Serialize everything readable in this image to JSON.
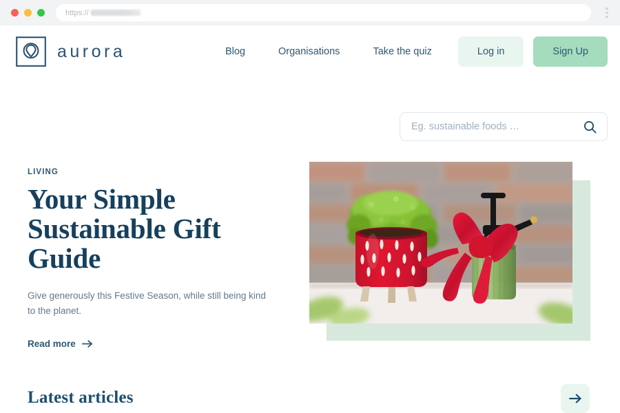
{
  "browser": {
    "url_scheme": "https://",
    "url_redacted": true,
    "menu_icon": "kebab-menu-icon",
    "traffic_lights": [
      "close-red",
      "minimize-yellow",
      "maximize-green"
    ]
  },
  "header": {
    "brand_name": "aurora",
    "logo_icon": "aurora-pin-logo",
    "nav_links": [
      {
        "label": "Blog"
      },
      {
        "label": "Organisations"
      },
      {
        "label": "Take the quiz"
      }
    ],
    "login_label": "Log in",
    "signup_label": "Sign Up"
  },
  "search": {
    "placeholder": "Eg. sustainable foods …",
    "value": "",
    "icon": "search-icon"
  },
  "hero": {
    "kicker": "LIVING",
    "title": "Your Simple Sustainable Gift Guide",
    "subtitle": "Give generously this Festive Season, while still being kind to the planet.",
    "read_more_label": "Read more",
    "read_more_icon": "arrow-right-icon",
    "image_alt": "Strawberry-patterned plant pot with microgreens beside a green glass mister tied with a red ribbon bow, against a brick wall"
  },
  "latest": {
    "heading": "Latest articles",
    "next_icon": "arrow-right-icon"
  },
  "colors": {
    "brand_navy": "#2d5875",
    "heading_navy": "#16405d",
    "body_gray": "#62798c",
    "mint_light": "#e9f6f0",
    "mint_accent": "#d6e9dc",
    "mint_button": "#a5dcbd",
    "page_bg": "#ffffff",
    "chrome_bg": "#f2f3f4"
  }
}
